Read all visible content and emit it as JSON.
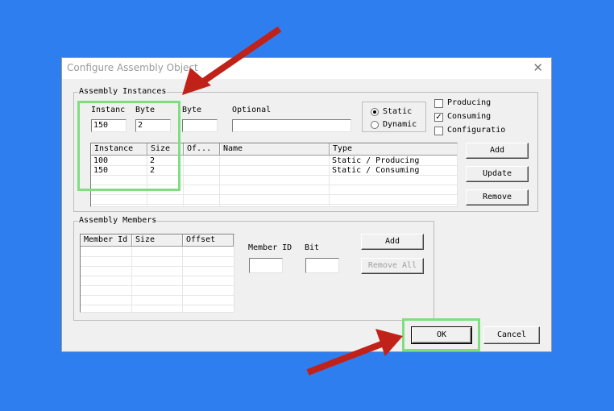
{
  "window": {
    "title": "Configure Assembly Object",
    "close_glyph": "✕"
  },
  "assembly_instances": {
    "group_label": "Assembly Instances",
    "instance_label": "Instanc",
    "byte_label_1": "Byte",
    "byte_label_2": "Byte",
    "optional_label": "Optional",
    "instance_value": "150",
    "byte_value": "2",
    "byte2_value": "",
    "optional_value": "",
    "radio_static": "Static",
    "radio_dynamic": "Dynamic",
    "selected_radio": "Static",
    "check_producing": "Producing",
    "check_consuming": "Consuming",
    "check_configuration": "Configuratio",
    "checked": {
      "producing": false,
      "consuming": true,
      "configuration": false
    },
    "table": {
      "columns": [
        "Instance",
        "Size",
        "Of...",
        "Name",
        "Type"
      ],
      "rows": [
        [
          "100",
          "2",
          "",
          "",
          "Static / Producing"
        ],
        [
          "150",
          "2",
          "",
          "",
          "Static / Consuming"
        ]
      ]
    },
    "buttons": {
      "add": "Add",
      "update": "Update",
      "remove": "Remove"
    }
  },
  "assembly_members": {
    "group_label": "Assembly Members",
    "columns": [
      "Member Id",
      "Size",
      "Offset"
    ],
    "member_id_label": "Member ID",
    "bit_label": "Bit",
    "member_id_value": "",
    "bit_value": "",
    "buttons": {
      "add": "Add",
      "remove_all": "Remove All"
    }
  },
  "footer": {
    "ok": "OK",
    "cancel": "Cancel"
  },
  "colors": {
    "background": "#2e7ef0",
    "highlight": "#7ddf7d",
    "arrow": "#c0221a"
  },
  "icons": {
    "close": "close-icon",
    "check": "check-icon",
    "arrow": "red-arrow-annotation"
  }
}
